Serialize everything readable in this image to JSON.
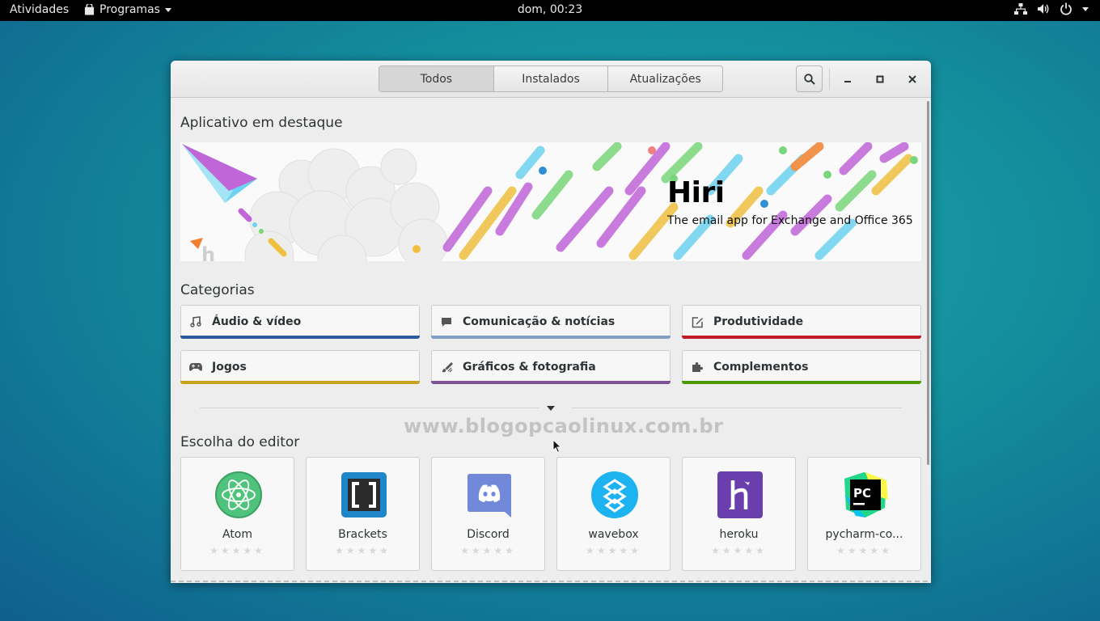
{
  "topbar": {
    "activities": "Atividades",
    "apps_menu": "Programas",
    "clock": "dom, 00:23"
  },
  "tabs": [
    {
      "label": "Todos",
      "active": true
    },
    {
      "label": "Instalados",
      "active": false
    },
    {
      "label": "Atualizações",
      "active": false
    }
  ],
  "featured": {
    "heading": "Aplicativo em destaque",
    "app_name": "Hiri",
    "description": "The email app for Exchange and Office 365"
  },
  "categories": {
    "heading": "Categorias",
    "items": [
      {
        "label": "Áudio & vídeo",
        "icon": "music-note-icon",
        "color": "#2a5d9e"
      },
      {
        "label": "Comunicação & notícias",
        "icon": "chat-bubble-icon",
        "color": "#7f9ec2"
      },
      {
        "label": "Produtividade",
        "icon": "edit-icon",
        "color": "#c01c28"
      },
      {
        "label": "Jogos",
        "icon": "gamepad-icon",
        "color": "#c8a21c"
      },
      {
        "label": "Gráficos & fotografia",
        "icon": "brush-icon",
        "color": "#7e5296"
      },
      {
        "label": "Complementos",
        "icon": "puzzle-icon",
        "color": "#4e9a06"
      }
    ]
  },
  "watermark": "www.blogopcaolinux.com.br",
  "editors_choice": {
    "heading": "Escolha do editor",
    "apps": [
      {
        "name": "Atom",
        "icon": "atom-icon",
        "stars": "★★★★★"
      },
      {
        "name": "Brackets",
        "icon": "brackets-icon",
        "stars": "★★★★★"
      },
      {
        "name": "Discord",
        "icon": "discord-icon",
        "stars": "★★★★★"
      },
      {
        "name": "wavebox",
        "icon": "wavebox-icon",
        "stars": "★★★★★"
      },
      {
        "name": "heroku",
        "icon": "heroku-icon",
        "stars": "★★★★★"
      },
      {
        "name": "pycharm-co...",
        "icon": "pycharm-icon",
        "stars": "★★★★★"
      }
    ]
  }
}
